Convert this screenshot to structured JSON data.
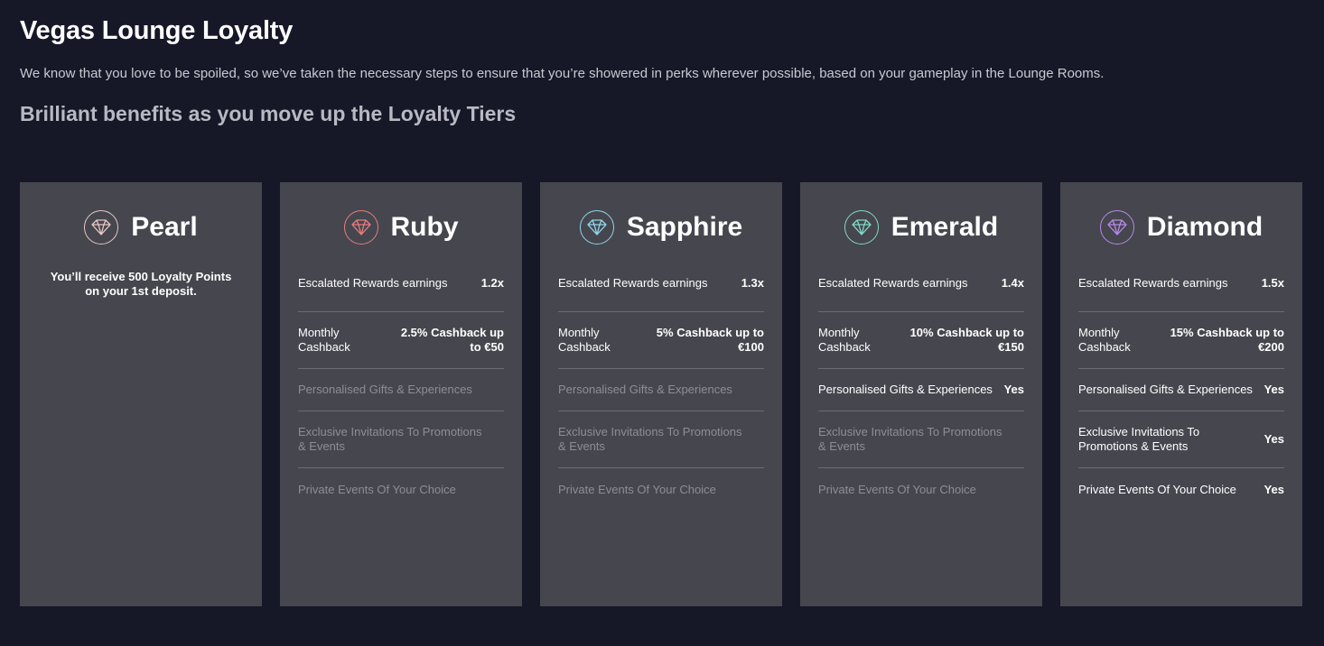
{
  "header": {
    "title": "Vegas Lounge Loyalty",
    "intro": "We know that you love to be spoiled, so we’ve taken the necessary steps to ensure that you’re showered in perks wherever possible, based on your gameplay in the Lounge Rooms.",
    "subtitle": "Brilliant benefits as you move up the Loyalty Tiers"
  },
  "colors": {
    "pearl": "#e7c6c1",
    "ruby": "#e77c7c",
    "sapphire": "#8fd6ea",
    "emerald": "#7fd9c6",
    "diamond": "#b58ae6"
  },
  "tiers": [
    {
      "name": "Pearl",
      "icon": "diamond-gem-icon",
      "description": "You’ll receive 500 Loyalty Points on your 1st deposit."
    },
    {
      "name": "Ruby",
      "icon": "diamond-gem-icon",
      "benefits": [
        {
          "label": "Escalated Rewards earnings",
          "value": "1.2x"
        },
        {
          "label": "Monthly Cashback",
          "value": "2.5% Cashback up to €50"
        },
        {
          "label": "Personalised Gifts & Experiences",
          "value": ""
        },
        {
          "label": "Exclusive Invitations To Promotions & Events",
          "value": ""
        },
        {
          "label": "Private Events Of Your Choice",
          "value": ""
        }
      ]
    },
    {
      "name": "Sapphire",
      "icon": "diamond-gem-icon",
      "benefits": [
        {
          "label": "Escalated Rewards earnings",
          "value": "1.3x"
        },
        {
          "label": "Monthly Cashback",
          "value": "5% Cashback up to €100"
        },
        {
          "label": "Personalised Gifts & Experiences",
          "value": ""
        },
        {
          "label": "Exclusive Invitations To Promotions & Events",
          "value": ""
        },
        {
          "label": "Private Events Of Your Choice",
          "value": ""
        }
      ]
    },
    {
      "name": "Emerald",
      "icon": "diamond-gem-icon",
      "benefits": [
        {
          "label": "Escalated Rewards earnings",
          "value": "1.4x"
        },
        {
          "label": "Monthly Cashback",
          "value": "10% Cashback up to €150"
        },
        {
          "label": "Personalised Gifts & Experiences",
          "value": "Yes"
        },
        {
          "label": "Exclusive Invitations To Promotions & Events",
          "value": ""
        },
        {
          "label": "Private Events Of Your Choice",
          "value": ""
        }
      ]
    },
    {
      "name": "Diamond",
      "icon": "diamond-gem-icon",
      "benefits": [
        {
          "label": "Escalated Rewards earnings",
          "value": "1.5x"
        },
        {
          "label": "Monthly Cashback",
          "value": "15% Cashback up to €200"
        },
        {
          "label": "Personalised Gifts & Experiences",
          "value": "Yes"
        },
        {
          "label": "Exclusive Invitations To Promotions & Events",
          "value": "Yes"
        },
        {
          "label": "Private Events Of Your Choice",
          "value": "Yes"
        }
      ]
    }
  ]
}
